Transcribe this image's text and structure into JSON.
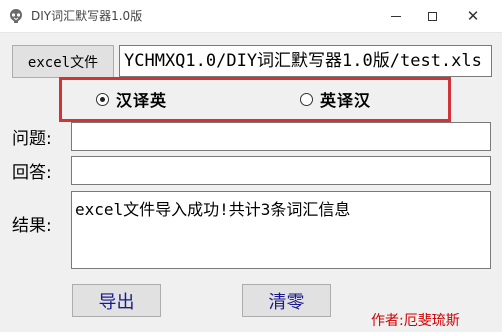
{
  "window": {
    "title": "DIY词汇默写器1.0版",
    "controls": [
      "minimize",
      "maximize",
      "close"
    ],
    "close_glyph": "✕"
  },
  "toolbar": {
    "excel_button_label": "excel文件",
    "file_path": "YCHMXQ1.0/DIY词汇默写器1.0版/test.xls"
  },
  "mode": {
    "options": [
      {
        "label": "汉译英",
        "selected": true
      },
      {
        "label": "英译汉",
        "selected": false
      }
    ],
    "highlight_color": "#d13438"
  },
  "form": {
    "question_label": "问题:",
    "question_value": "",
    "answer_label": "回答:",
    "answer_value": "",
    "result_label": "结果:",
    "result_value": "excel文件导入成功!共计3条词汇信息"
  },
  "actions": {
    "export_label": "导出",
    "clear_label": "清零"
  },
  "footer": {
    "author_text": "作者:厄斐琉斯"
  },
  "icons": {
    "app": "app-logo-icon",
    "minimize": "minimize-icon",
    "maximize": "maximize-icon",
    "close": "close-icon"
  }
}
